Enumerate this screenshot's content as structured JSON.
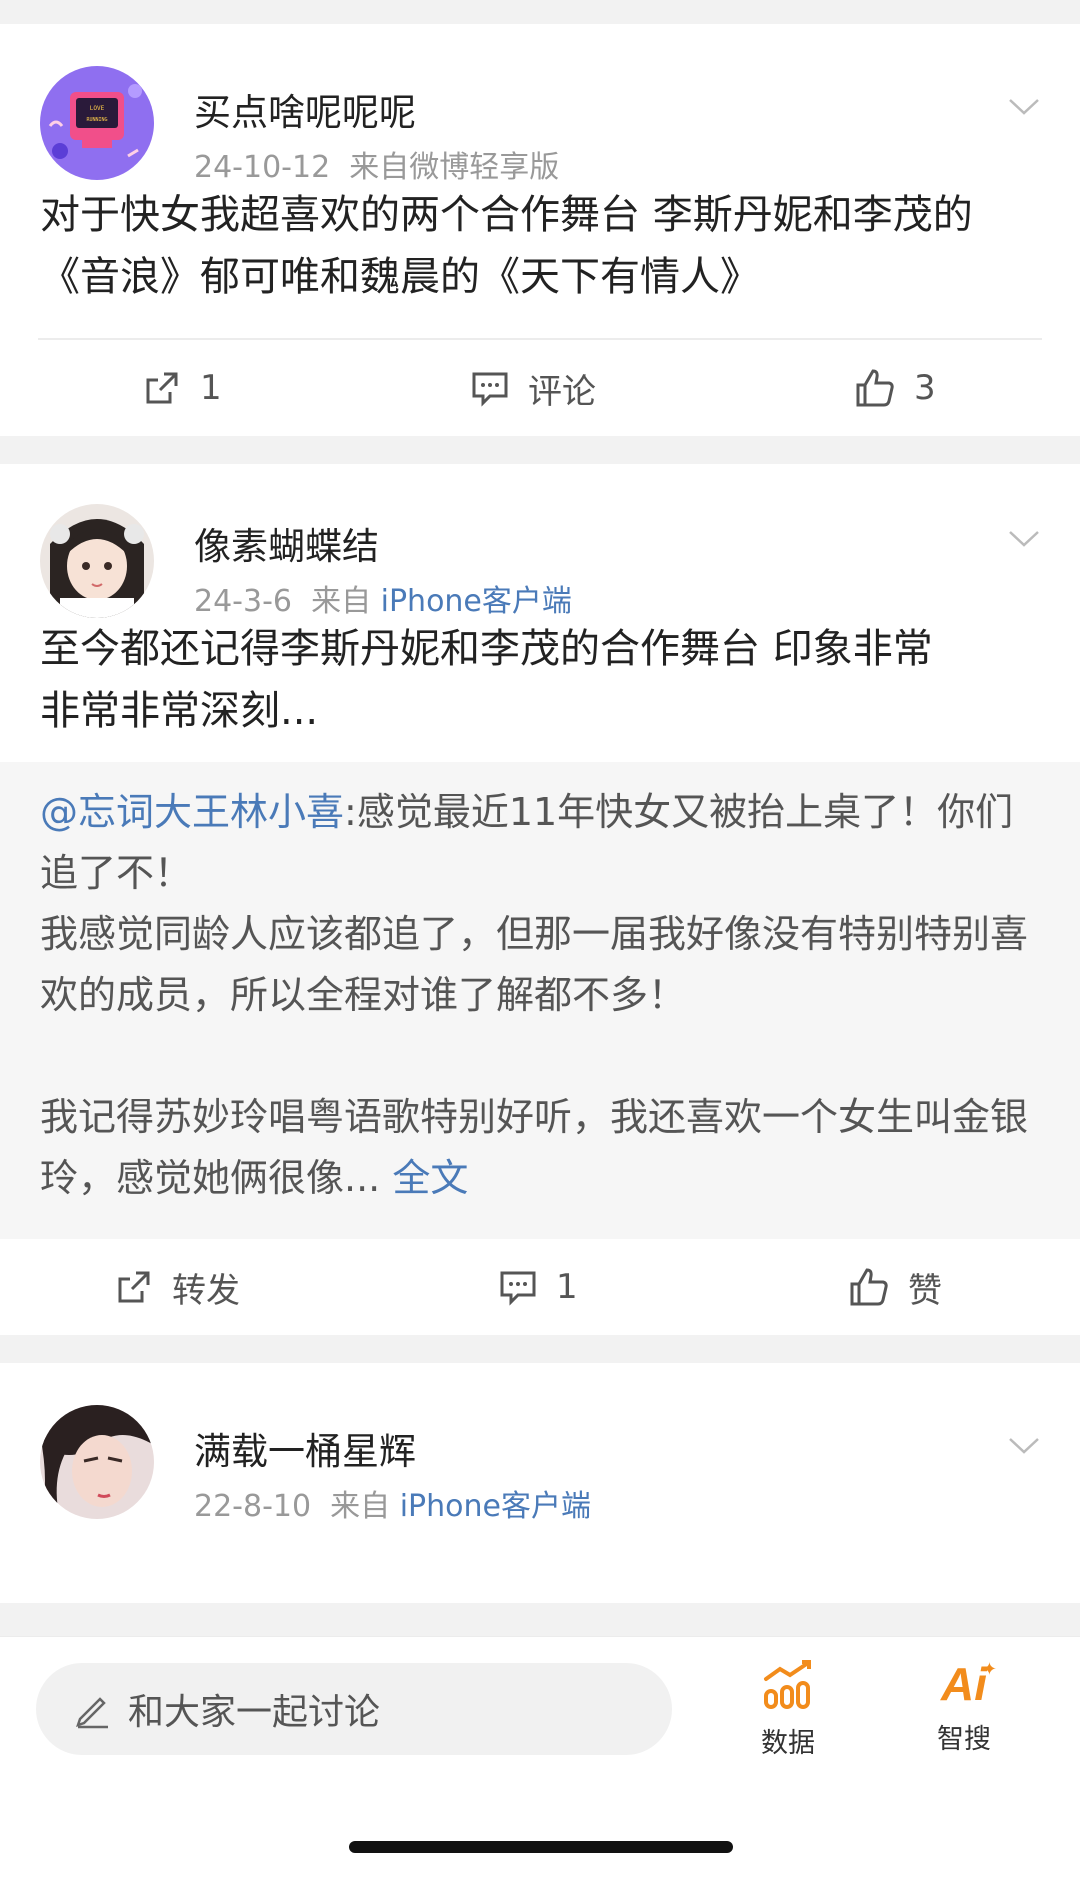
{
  "posts": [
    {
      "username": "买点啥呢呢呢",
      "date": "24-10-12",
      "source_prefix": "来自",
      "source": "微博轻享版",
      "text": "对于快女我超喜欢的两个合作舞台 李斯丹妮和李茂的《音浪》郁可唯和魏晨的《天下有情人》",
      "actions": {
        "repost": "1",
        "comment": "评论",
        "like": "3"
      }
    },
    {
      "username": "像素蝴蝶结",
      "date": "24-3-6",
      "source_prefix": "来自",
      "source": "iPhone客户端",
      "text_line1": "至今都还记得李斯丹妮和李茂的合作舞台 印象非常",
      "text_line2": "非常非常深刻...",
      "repost": {
        "mention": "@忘词大王林小喜",
        "para1_rest": ":感觉最近11年快女又被抬上桌了！你们追了不！",
        "para2": "我感觉同龄人应该都追了，但那一届我好像没有特别特别喜欢的成员，所以全程对谁了解都不多！",
        "para3": "我记得苏妙玲唱粤语歌特别好听，我还喜欢一个女生叫金银玲，感觉她俩很像...",
        "full_text_link": "全文"
      },
      "actions": {
        "repost": "转发",
        "comment": "1",
        "like": "赞"
      }
    },
    {
      "username": "满载一桶星辉",
      "date": "22-8-10",
      "source_prefix": "来自",
      "source": "iPhone客户端"
    }
  ],
  "bottom_bar": {
    "input_placeholder": "和大家一起讨论",
    "data_label": "数据",
    "ai_label": "智搜",
    "ai_icon_text": "Ai"
  },
  "colors": {
    "link": "#4a7ab8",
    "accent_orange": "#f28c1c",
    "meta_gray": "#999999"
  }
}
